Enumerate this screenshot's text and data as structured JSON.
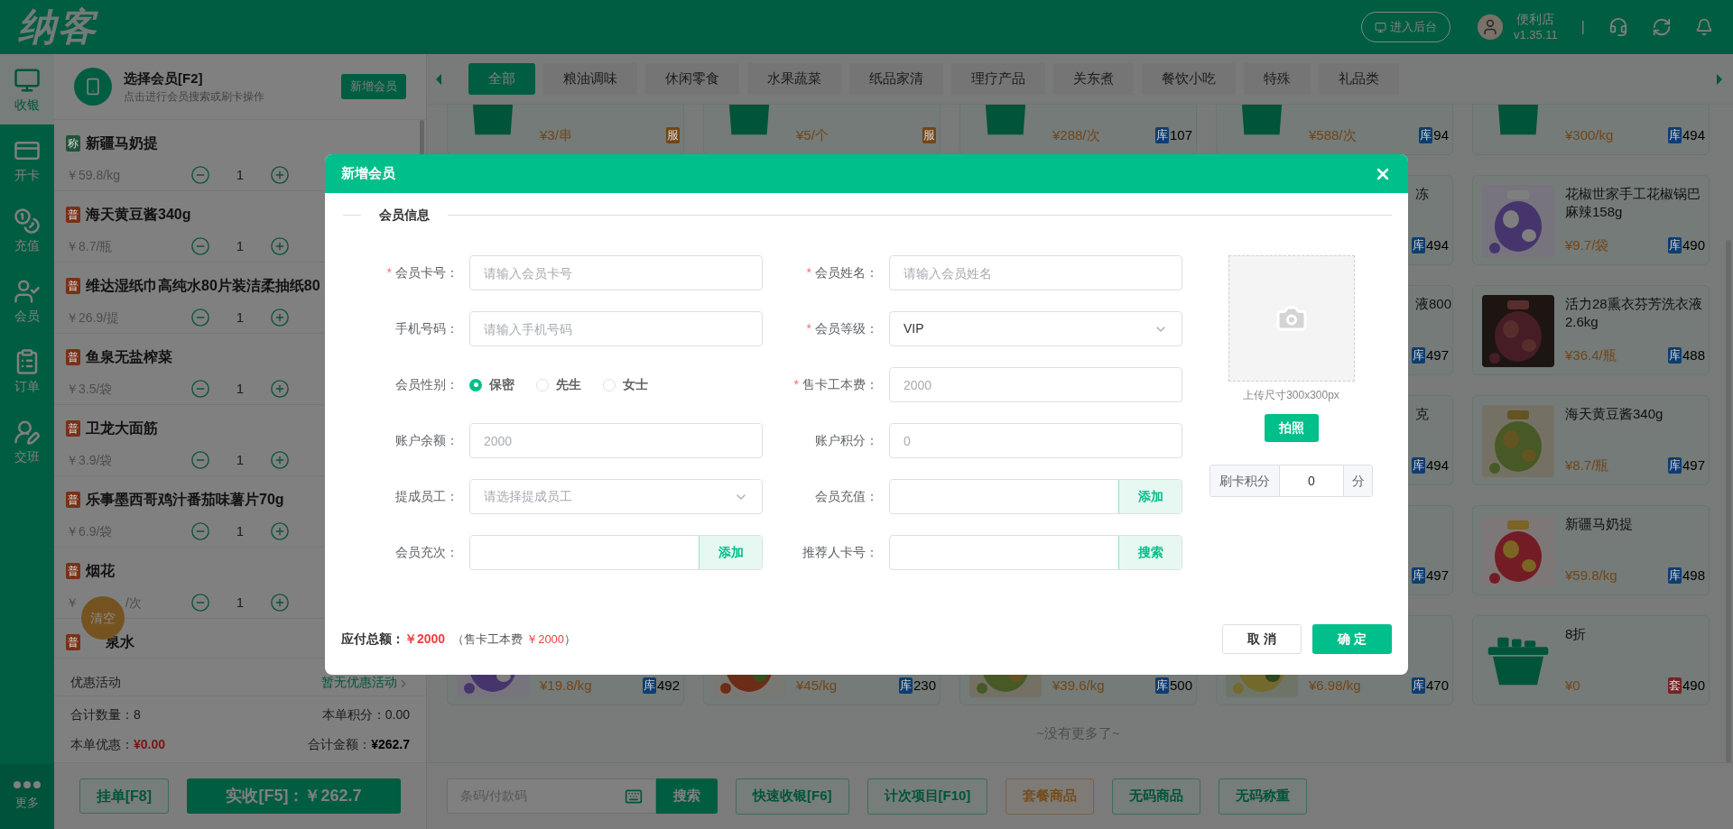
{
  "brand": {
    "logo": "纳客"
  },
  "topbar": {
    "admin_button": "进入后台",
    "store_name": "便利店",
    "version": "v1.35.11",
    "separator": "|"
  },
  "nav": {
    "items": [
      {
        "label": "收银",
        "kind": "register",
        "selected": true
      },
      {
        "label": "开卡",
        "kind": "card",
        "selected": false
      },
      {
        "label": "充值",
        "kind": "recharge",
        "selected": false
      },
      {
        "label": "会员",
        "kind": "member",
        "selected": false
      },
      {
        "label": "订单",
        "kind": "order",
        "selected": false
      },
      {
        "label": "交班",
        "kind": "shift",
        "selected": false
      }
    ],
    "more": "更多"
  },
  "member": {
    "title": "选择会员[F2]",
    "hint": "点击进行会员搜索或刷卡操作",
    "add_button": "新增会员"
  },
  "cart": {
    "items": [
      {
        "tag": "称",
        "color": "#205439",
        "name": "新疆马奶提",
        "price": "￥59.8/kg",
        "qty": "1"
      },
      {
        "tag": "普",
        "color": "#783115",
        "name": "海天黄豆酱340g",
        "price": "￥8.7/瓶",
        "qty": "1"
      },
      {
        "tag": "普",
        "color": "#783115",
        "name": "维达湿纸巾高纯水80片装洁柔抽纸80",
        "price": "￥26.9/提",
        "qty": "1"
      },
      {
        "tag": "普",
        "color": "#783115",
        "name": "鱼泉无盐榨菜",
        "price": "￥3.5/袋",
        "qty": "1"
      },
      {
        "tag": "普",
        "color": "#783115",
        "name": "卫龙大面筋",
        "price": "￥3.9/袋",
        "qty": "1"
      },
      {
        "tag": "普",
        "color": "#783115",
        "name": "乐事墨西哥鸡汁番茄味薯片70g",
        "price": "￥6.9/袋",
        "qty": "1"
      },
      {
        "tag": "普",
        "color": "#783115",
        "name": "烟花",
        "price": "￥",
        "price_suffix": "/次",
        "qty": "1"
      },
      {
        "tag": "普",
        "color": "#783115",
        "name": "泉水",
        "name_covered": true
      }
    ],
    "clear_button": "清空"
  },
  "promo": {
    "label": "优惠活动",
    "value": "暂无优惠活动"
  },
  "totals": [
    {
      "label": "合计数量：",
      "value": "8",
      "kind": "plain"
    },
    {
      "label": "本单积分：",
      "value": "0.00",
      "kind": "plain"
    },
    {
      "label": "本单优惠：",
      "value": "¥0.00",
      "kind": "discount"
    },
    {
      "label": "合计金额：",
      "value": "¥262.7",
      "kind": "total"
    }
  ],
  "cart_actions": {
    "hold": "挂单[F8]",
    "pay": "实收[F5]：￥262.7"
  },
  "categories": [
    {
      "label": "全部",
      "selected": true
    },
    {
      "label": "粮油调味",
      "selected": false
    },
    {
      "label": "休闲零食",
      "selected": false
    },
    {
      "label": "水果蔬菜",
      "selected": false
    },
    {
      "label": "纸品家清",
      "selected": false
    },
    {
      "label": "理疗产品",
      "selected": false
    },
    {
      "label": "关东煮",
      "selected": false
    },
    {
      "label": "餐饮小吃",
      "selected": false
    },
    {
      "label": "特殊",
      "selected": false
    },
    {
      "label": "礼品类",
      "selected": false
    }
  ],
  "product_rows": [
    [
      {
        "kind": "bag",
        "price": "¥3/串",
        "badge": {
          "label": "服",
          "color": "#734516"
        }
      },
      {
        "kind": "bag",
        "price": "¥5/个",
        "badge": {
          "label": "服",
          "color": "#734516"
        }
      },
      {
        "kind": "bag",
        "price": "¥288/次",
        "badge": {
          "label": "库",
          "color": "#0e3e70"
        },
        "stock": "107"
      },
      {
        "kind": "bag",
        "price": "¥588/次",
        "badge": {
          "label": "库",
          "color": "#0e3e70"
        },
        "stock": "94"
      },
      {
        "kind": "bag",
        "price": "¥300/kg",
        "badge": {
          "label": "库",
          "color": "#0e3e70"
        },
        "stock": "494"
      }
    ],
    [
      null,
      null,
      null,
      {
        "name": "冻",
        "clipped": true,
        "badge": {
          "label": "库",
          "color": "#0e3e70"
        },
        "stock": "494"
      },
      {
        "kind": "picture",
        "name": "花椒世家手工花椒锅巴麻辣158g",
        "price": "¥9.7/袋",
        "badge": {
          "label": "库",
          "color": "#0e3e70"
        },
        "stock": "490"
      }
    ],
    [
      null,
      null,
      null,
      {
        "name": "液800",
        "clipped": true,
        "badge": {
          "label": "库",
          "color": "#0e3e70"
        },
        "stock": "497"
      },
      {
        "kind": "picture",
        "name": "活力28熏衣芬芳洗衣液2.6kg",
        "price": "¥36.4/瓶",
        "badge": {
          "label": "库",
          "color": "#0e3e70"
        },
        "stock": "488"
      }
    ],
    [
      null,
      null,
      null,
      {
        "name": "克",
        "clipped": true,
        "badge": {
          "label": "库",
          "color": "#0e3e70"
        },
        "stock": "494"
      },
      {
        "kind": "picture",
        "name": "海天黄豆酱340g",
        "price": "¥8.7/瓶",
        "badge": {
          "label": "库",
          "color": "#0e3e70"
        },
        "stock": "497"
      }
    ],
    [
      null,
      null,
      null,
      {
        "badge": {
          "label": "库",
          "color": "#0e3e70"
        },
        "stock": "497"
      },
      {
        "kind": "picture",
        "name": "新疆马奶提",
        "price": "¥59.8/kg",
        "badge": {
          "label": "库",
          "color": "#0e3e70"
        },
        "stock": "498"
      }
    ],
    [
      {
        "kind": "picture",
        "price": "¥19.8/kg",
        "badge": {
          "label": "库",
          "color": "#0e3e70"
        },
        "stock": "492"
      },
      {
        "kind": "picture",
        "price": "¥45/kg",
        "badge": {
          "label": "库",
          "color": "#0e3e70"
        },
        "stock": "230"
      },
      {
        "kind": "picture",
        "price": "¥39.6/kg",
        "badge": {
          "label": "库",
          "color": "#0e3e70"
        },
        "stock": "500"
      },
      {
        "kind": "picture",
        "price": "¥6.98/kg",
        "badge": {
          "label": "库",
          "color": "#0e3e70"
        },
        "stock": "470"
      },
      {
        "kind": "basket",
        "name": "8折",
        "price": "¥0",
        "badge": {
          "label": "套",
          "color": "#742323"
        },
        "stock": "490"
      }
    ]
  ],
  "end_text": "~没有更多了~",
  "toolbar": {
    "search_placeholder": "条码/付款码",
    "search_button": "搜索",
    "buttons": [
      {
        "label": "快速收银[F6]",
        "kind": "primary"
      },
      {
        "label": "计次项目[F10]",
        "kind": "primary"
      },
      {
        "label": "套餐商品",
        "kind": "warning"
      },
      {
        "label": "无码商品",
        "kind": "primary"
      },
      {
        "label": "无码称重",
        "kind": "primary"
      }
    ]
  },
  "modal": {
    "title": "新增会员",
    "section": "会员信息",
    "fields": [
      {
        "kind": "text",
        "label": "会员卡号：",
        "mark": "*",
        "placeholder": "请输入会员卡号"
      },
      {
        "kind": "text",
        "label": "会员姓名：",
        "mark": "*",
        "placeholder": "请输入会员姓名"
      },
      {
        "kind": "text",
        "label": "手机号码：",
        "placeholder": "请输入手机号码"
      },
      {
        "kind": "select",
        "label": "会员等级：",
        "mark": "*",
        "value": "VIP"
      },
      {
        "kind": "radio",
        "label": "会员性别：",
        "options": [
          {
            "label": "保密",
            "selected": true
          },
          {
            "label": "先生",
            "selected": false
          },
          {
            "label": "女士",
            "selected": false
          }
        ]
      },
      {
        "kind": "text",
        "label": "售卡工本费：",
        "mark": "*",
        "placeholder": "2000"
      },
      {
        "kind": "text",
        "label": "账户余额：",
        "placeholder": "2000"
      },
      {
        "kind": "text",
        "label": "账户积分：",
        "placeholder": "0"
      },
      {
        "kind": "select",
        "label": "提成员工：",
        "placeholder": "请选择提成员工"
      },
      {
        "kind": "addon",
        "label": "会员充值：",
        "button": "添加"
      },
      {
        "kind": "addon",
        "label": "会员充次：",
        "button": "添加"
      },
      {
        "kind": "addon",
        "label": "推荐人卡号：",
        "button": "搜索"
      }
    ],
    "photo": {
      "caption": "上传尺寸300x300px",
      "button": "拍照"
    },
    "points": {
      "label": "刷卡积分",
      "value": "0",
      "unit": "分"
    },
    "footer": {
      "total_label": "应付总额：",
      "total": "￥2000",
      "note_open": "（售卡工本费",
      "note_amount": "￥2000",
      "note_close": "）"
    },
    "cancel": "取 消",
    "confirm": "确 定"
  }
}
